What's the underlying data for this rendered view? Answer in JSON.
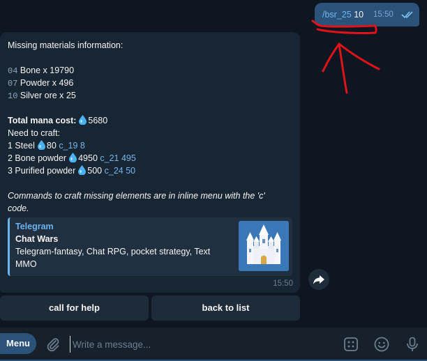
{
  "outgoing": {
    "command": "/bsr_25",
    "arg": "10",
    "time": "15:50"
  },
  "message": {
    "header": "Missing materials information:",
    "materials": [
      {
        "code": "04",
        "text": "Bone x 19790"
      },
      {
        "code": "07",
        "text": "Powder x 496"
      },
      {
        "code": "10",
        "text": "Silver ore x 25"
      }
    ],
    "mana_label": "Total mana cost:",
    "mana_value": "5680",
    "need_label": "Need to craft:",
    "crafts": [
      {
        "text": "1 Steel",
        "mana": "80",
        "cmd": "c_19 8"
      },
      {
        "text": "2 Bone powder",
        "mana": "4950",
        "cmd": "c_21 495"
      },
      {
        "text": "3 Purified powder",
        "mana": "500",
        "cmd": "c_24 50"
      }
    ],
    "note_line1": "Commands to craft missing elements are in inline menu with the 'c'",
    "note_line2": "code.",
    "preview": {
      "site": "Telegram",
      "title": "Chat Wars",
      "desc": "Telegram-fantasy, Chat RPG, pocket strategy, Text MMO"
    },
    "time": "15:50"
  },
  "keyboard": {
    "help": "call for help",
    "back": "back to list"
  },
  "composer": {
    "menu": "Menu",
    "placeholder": "Write a message..."
  },
  "icons": {
    "drop": "droplet-icon",
    "read": "double-check-icon",
    "forward": "forward-arrow-icon",
    "attach": "paperclip-icon",
    "commands": "bot-commands-icon",
    "emoji": "emoji-icon",
    "mic": "microphone-icon"
  },
  "colors": {
    "background": "#0e1621",
    "outgoing_bubble": "#2b5278",
    "incoming_bubble": "#182533",
    "link": "#71b6ef",
    "annotation": "#e0131a"
  }
}
